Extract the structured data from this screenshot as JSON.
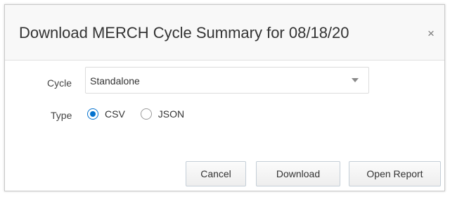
{
  "dialog": {
    "title": "Download MERCH Cycle Summary for 08/18/20",
    "close_glyph": "×"
  },
  "form": {
    "cycle": {
      "label": "Cycle",
      "value": "Standalone",
      "icon": "chevron-down-icon"
    },
    "type": {
      "label": "Type",
      "selected": "CSV",
      "options": [
        "CSV",
        "JSON"
      ]
    }
  },
  "buttons": {
    "cancel": "Cancel",
    "download": "Download",
    "open_report": "Open Report"
  },
  "colors": {
    "accent": "#0572ce",
    "header_bg": "#f8f8f8",
    "button_border": "#c4ced7"
  }
}
